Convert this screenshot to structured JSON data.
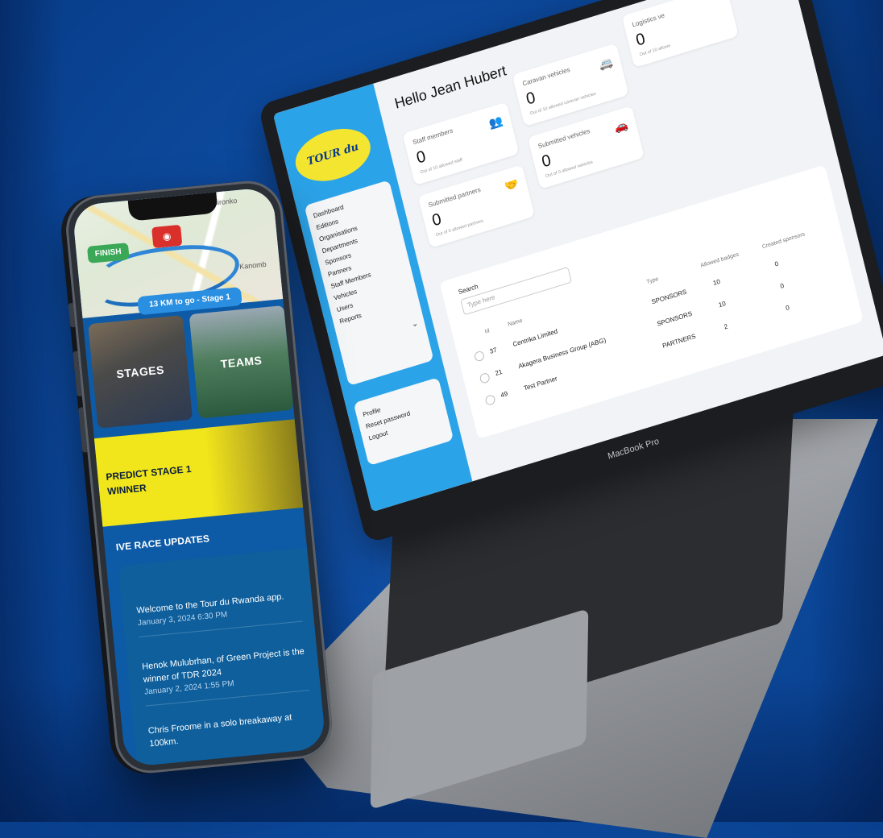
{
  "phone": {
    "map": {
      "place_labels": [
        "Kimironko",
        "Kanomb"
      ],
      "finish_badge": "FINISH",
      "km_pill": "13 KM to go - Stage 1"
    },
    "tiles": [
      {
        "label": "STAGES"
      },
      {
        "label": "TEAMS"
      }
    ],
    "predict": {
      "label": "PREDICT STAGE 1 WINNER"
    },
    "live_header": "IVE RACE UPDATES",
    "updates": [
      {
        "text": "Welcome to the Tour du Rwanda app.",
        "date": "January 3, 2024 6:30 PM"
      },
      {
        "text": "Henok Mulubrhan, of Green Project is the winner of TDR 2024",
        "date": "January 2, 2024 1:55 PM"
      },
      {
        "text": "Chris Froome in a solo breakaway at 100km.",
        "date": ""
      }
    ]
  },
  "laptop": {
    "brand_label": "MacBook Pro",
    "logo_text": "TOUR du RWANDA",
    "greeting": "Hello Jean Hubert",
    "nav": [
      "Dashboard",
      "Editions",
      "Organisations",
      "Departments",
      "Sponsors",
      "Partners",
      "Staff Members",
      "Vehicles",
      "Users",
      "Reports"
    ],
    "profile_menu": [
      "Profile",
      "Reset password",
      "Logout"
    ],
    "stats": [
      {
        "label": "Staff members",
        "value": "0",
        "sub": "Out of 10 allowed staff",
        "icon": "users-icon"
      },
      {
        "label": "Caravan vehicles",
        "value": "0",
        "sub": "Out of 10 allowed caravan vehicles",
        "icon": "van-icon"
      },
      {
        "label": "Logistics ve",
        "value": "0",
        "sub": "Out of 10 allowe",
        "icon": ""
      },
      {
        "label": "Submitted partners",
        "value": "0",
        "sub": "Out of 0 allowed partners",
        "icon": "handshake-icon"
      },
      {
        "label": "Submitted vehicles",
        "value": "0",
        "sub": "Out of 0 allowed vehicles",
        "icon": "car-icon"
      }
    ],
    "table": {
      "search_label": "Search",
      "search_placeholder": "Type here",
      "columns": [
        "Id",
        "Name",
        "Type",
        "Allowed badges",
        "Created sponsors"
      ],
      "rows": [
        {
          "id": "37",
          "name": "Centrika Limited",
          "type": "SPONSORS",
          "allowed": "10",
          "created": "0"
        },
        {
          "id": "21",
          "name": "Akagera Business Group (ABG)",
          "type": "SPONSORS",
          "allowed": "10",
          "created": "0"
        },
        {
          "id": "49",
          "name": "Test Partner",
          "type": "PARTNERS",
          "allowed": "2",
          "created": "0"
        }
      ]
    }
  },
  "colors": {
    "background": "#0d4a9e",
    "sidebar_blue": "#2ba3e8",
    "predict_yellow": "#f1e51b",
    "finish_green": "#3aa856"
  }
}
